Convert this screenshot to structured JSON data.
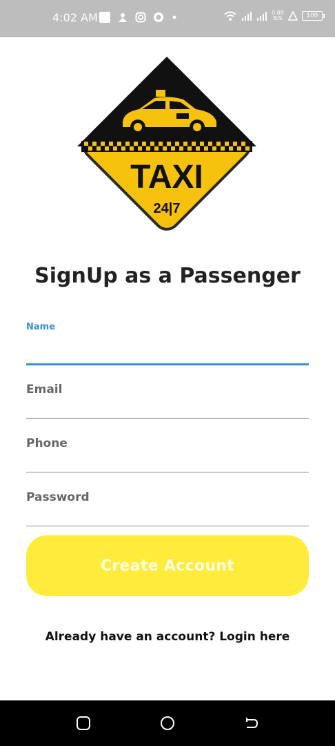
{
  "status_bar": {
    "time": "4:02 AM",
    "net_speed_value": "0.00",
    "net_speed_unit": "B/S",
    "battery": "100",
    "icons": [
      "notification-square-icon",
      "app-icon",
      "instagram-icon",
      "github-icon",
      "dot-icon",
      "wifi-icon",
      "signal-icon",
      "signal-icon",
      "network-speed-icon",
      "alert-triangle-icon",
      "battery-icon"
    ]
  },
  "logo": {
    "word": "TAXI",
    "subtitle": "24|7",
    "colors": {
      "yellow": "#f7c20e",
      "black": "#111111"
    }
  },
  "page": {
    "title": "SignUp as a Passenger"
  },
  "form": {
    "name_label": "Name",
    "email_placeholder": "Email",
    "phone_placeholder": "Phone",
    "password_placeholder": "Password",
    "accent_color": "#3a8fd6"
  },
  "actions": {
    "create_account": "Create Account",
    "login_link": "Already have an account? Login here",
    "button_color": "#ffeb3b"
  },
  "nav_bar": {
    "buttons": [
      "recents-icon",
      "home-icon",
      "back-icon"
    ]
  }
}
